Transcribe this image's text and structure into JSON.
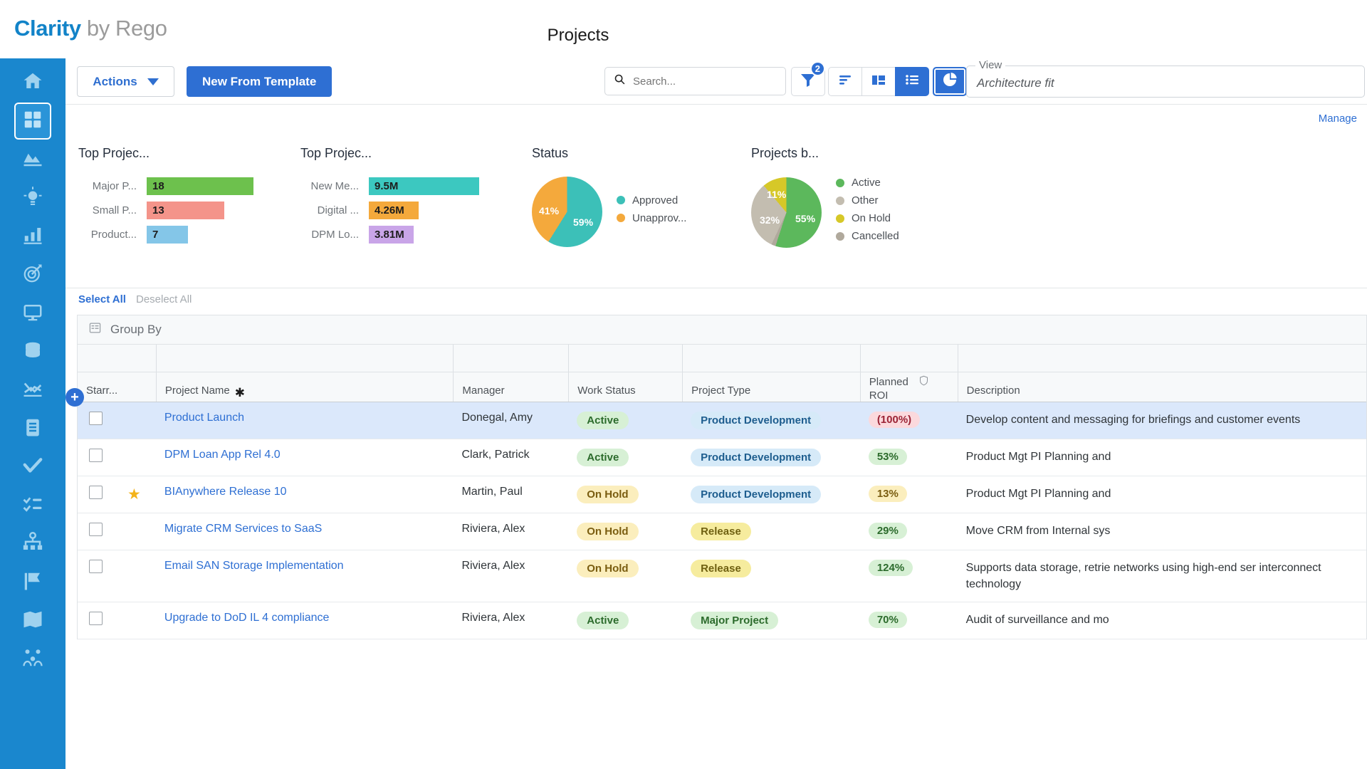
{
  "brand": {
    "name": "Clarity",
    "suffix": "by Rego"
  },
  "header": {
    "title": "Projects",
    "manage_link": "Manage"
  },
  "sidebar": {
    "items": [
      {
        "icon": "home-icon",
        "name": "home"
      },
      {
        "icon": "grid-icon",
        "name": "projects",
        "active": true
      },
      {
        "icon": "mountain-icon",
        "name": "roadmaps"
      },
      {
        "icon": "lightbulb-icon",
        "name": "ideas"
      },
      {
        "icon": "bar-chart-icon",
        "name": "reports"
      },
      {
        "icon": "target-icon",
        "name": "goals"
      },
      {
        "icon": "monitor-icon",
        "name": "dashboards"
      },
      {
        "icon": "database-icon",
        "name": "data"
      },
      {
        "icon": "trend-line-icon",
        "name": "analytics"
      },
      {
        "icon": "clipboard-icon",
        "name": "tasks"
      },
      {
        "icon": "check-icon",
        "name": "approvals"
      },
      {
        "icon": "checklist-icon",
        "name": "todo"
      },
      {
        "icon": "hierarchy-icon",
        "name": "org"
      },
      {
        "icon": "kanban-flag-icon",
        "name": "boards"
      },
      {
        "icon": "map-icon",
        "name": "maps"
      },
      {
        "icon": "resources-icon",
        "name": "resources"
      }
    ]
  },
  "toolbar": {
    "actions_label": "Actions",
    "new_from_template_label": "New From Template",
    "search_placeholder": "Search...",
    "search_value": "",
    "filter_badge": "2",
    "buttons": [
      {
        "icon": "filter-icon",
        "name": "filter-button",
        "active": false
      },
      {
        "icon": "sort-icon",
        "name": "sort-button",
        "active": false
      },
      {
        "icon": "board-icon",
        "name": "board-view-button",
        "active": false
      },
      {
        "icon": "list-icon",
        "name": "list-view-button",
        "active": true
      },
      {
        "icon": "pie-chart-icon",
        "name": "chart-view-button",
        "active": true
      }
    ],
    "view_label": "View",
    "view_value": "Architecture fit"
  },
  "selection": {
    "select_all": "Select All",
    "deselect_all": "Deselect All"
  },
  "grid_controls": {
    "group_by": "Group By"
  },
  "chart_data": [
    {
      "type": "bar",
      "title": "Top Projec...",
      "orientation": "horizontal",
      "categories": [
        "Major P...",
        "Small P...",
        "Product..."
      ],
      "values": [
        18,
        13,
        7
      ],
      "value_labels": [
        "18",
        "13",
        "7"
      ],
      "colors": [
        "#6dc14d",
        "#f4948a",
        "#84c6e8"
      ],
      "xlabel": "",
      "ylabel": "",
      "max": 18
    },
    {
      "type": "bar",
      "title": "Top Projec...",
      "orientation": "horizontal",
      "categories": [
        "New Me...",
        "Digital ...",
        "DPM Lo..."
      ],
      "values": [
        9.5,
        4.26,
        3.81
      ],
      "value_labels": [
        "9.5M",
        "4.26M",
        "3.81M"
      ],
      "colors": [
        "#3cc8c0",
        "#f4a93c",
        "#c9a5e8"
      ],
      "xlabel": "",
      "ylabel": "",
      "max": 9.5
    },
    {
      "type": "pie",
      "title": "Status",
      "labels": [
        "Approved",
        "Unapprov..."
      ],
      "values": [
        59,
        41
      ],
      "value_labels": [
        "59%",
        "41%"
      ],
      "colors": [
        "#3cc0b8",
        "#f4a93c"
      ],
      "legend_position": "right"
    },
    {
      "type": "pie",
      "title": "Projects b...",
      "labels": [
        "Active",
        "Other",
        "On Hold",
        "Cancelled"
      ],
      "values": [
        55,
        32,
        11,
        2
      ],
      "value_labels": [
        "55%",
        "32%",
        "11%",
        ""
      ],
      "colors": [
        "#5cb85c",
        "#c3bdb0",
        "#d6c828",
        "#b0a99c"
      ],
      "legend_position": "right"
    }
  ],
  "table": {
    "columns": [
      {
        "label": "Starr...",
        "name": "starred"
      },
      {
        "label": "Project Name",
        "name": "project-name",
        "required": true
      },
      {
        "label": "Manager",
        "name": "manager"
      },
      {
        "label": "Work Status",
        "name": "work-status"
      },
      {
        "label": "Project Type",
        "name": "project-type"
      },
      {
        "label": "Planned ROI",
        "name": "planned-roi",
        "icon": "shield-icon"
      },
      {
        "label": "Description",
        "name": "description"
      }
    ],
    "rows": [
      {
        "checked": false,
        "starred": false,
        "selected": true,
        "name": "Product Launch",
        "manager": "Donegal, Amy",
        "work_status": "Active",
        "work_status_color": "#d7f0d5",
        "work_status_text": "#2c6b2c",
        "project_type": "Product Development",
        "project_type_color": "#d6eaf8",
        "project_type_text": "#1d5d8e",
        "roi": "(100%)",
        "roi_bg": "#fbd9dd",
        "roi_text": "#9b2335",
        "description": "Develop content and messaging for briefings and customer events"
      },
      {
        "checked": false,
        "starred": false,
        "selected": false,
        "name": "DPM Loan App Rel 4.0",
        "manager": "Clark, Patrick",
        "work_status": "Active",
        "work_status_color": "#d7f0d5",
        "work_status_text": "#2c6b2c",
        "project_type": "Product Development",
        "project_type_color": "#d6eaf8",
        "project_type_text": "#1d5d8e",
        "roi": "53%",
        "roi_bg": "#d7f0d5",
        "roi_text": "#2c6b2c",
        "description": "Product Mgt PI Planning and"
      },
      {
        "checked": false,
        "starred": true,
        "selected": false,
        "name": "BIAnywhere Release 10",
        "manager": "Martin, Paul",
        "work_status": "On Hold",
        "work_status_color": "#fbeebd",
        "work_status_text": "#7a5d10",
        "project_type": "Product Development",
        "project_type_color": "#d6eaf8",
        "project_type_text": "#1d5d8e",
        "roi": "13%",
        "roi_bg": "#fbeebd",
        "roi_text": "#7a5d10",
        "description": "Product Mgt PI Planning and"
      },
      {
        "checked": false,
        "starred": false,
        "selected": false,
        "name": "Migrate CRM Services to SaaS",
        "manager": "Riviera, Alex",
        "work_status": "On Hold",
        "work_status_color": "#fbeebd",
        "work_status_text": "#7a5d10",
        "project_type": "Release",
        "project_type_color": "#f6ec9e",
        "project_type_text": "#6f6011",
        "roi": "29%",
        "roi_bg": "#d7f0d5",
        "roi_text": "#2c6b2c",
        "description": "Move CRM from Internal sys"
      },
      {
        "checked": false,
        "starred": false,
        "selected": false,
        "name": "Email SAN Storage Implementation",
        "manager": "Riviera, Alex",
        "work_status": "On Hold",
        "work_status_color": "#fbeebd",
        "work_status_text": "#7a5d10",
        "project_type": "Release",
        "project_type_color": "#f6ec9e",
        "project_type_text": "#6f6011",
        "roi": "124%",
        "roi_bg": "#d7f0d5",
        "roi_text": "#2c6b2c",
        "description": "Supports data storage, retrie networks using high-end ser interconnect technology"
      },
      {
        "checked": false,
        "starred": false,
        "selected": false,
        "name": "Upgrade to DoD IL 4 compliance",
        "manager": "Riviera, Alex",
        "work_status": "Active",
        "work_status_color": "#d7f0d5",
        "work_status_text": "#2c6b2c",
        "project_type": "Major Project",
        "project_type_color": "#d7f0d5",
        "project_type_text": "#2c6b2c",
        "roi": "70%",
        "roi_bg": "#d7f0d5",
        "roi_text": "#2c6b2c",
        "description": "Audit of surveillance and mo"
      }
    ]
  }
}
